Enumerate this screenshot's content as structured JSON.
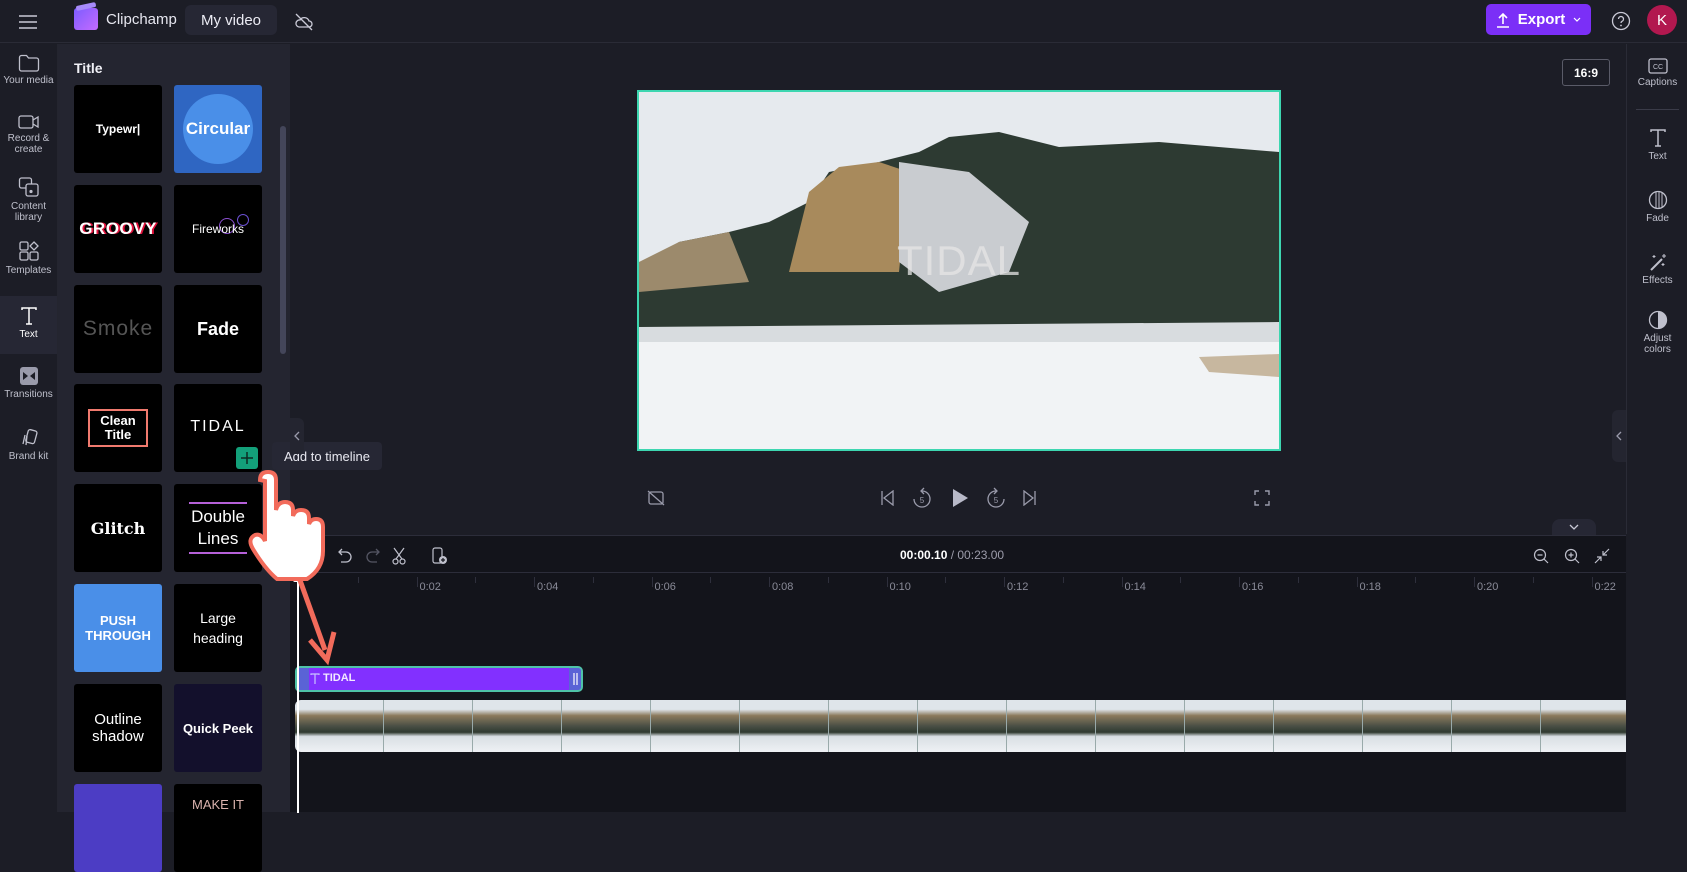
{
  "topbar": {
    "app_name": "Clipchamp",
    "project_title": "My video",
    "export_label": "Export",
    "avatar_initial": "K",
    "colors": {
      "export": "#7b2ff7",
      "avatar": "#b2184f"
    }
  },
  "left_rail": {
    "items": [
      {
        "label": "Your media",
        "icon": "folder-icon"
      },
      {
        "label": "Record & create",
        "icon": "camera-icon"
      },
      {
        "label": "Content library",
        "icon": "library-icon"
      },
      {
        "label": "Templates",
        "icon": "templates-icon"
      },
      {
        "label": "Text",
        "icon": "text-icon",
        "active": true
      },
      {
        "label": "Transitions",
        "icon": "transitions-icon"
      },
      {
        "label": "Brand kit",
        "icon": "brand-kit-icon"
      }
    ]
  },
  "panel": {
    "title": "Title",
    "tiles": [
      {
        "label": "Typewr|"
      },
      {
        "label": "Circular"
      },
      {
        "label": "GROOVY"
      },
      {
        "label": "Fireworks"
      },
      {
        "label": "Smoke"
      },
      {
        "label": "Fade"
      },
      {
        "label": "Clean Title"
      },
      {
        "label": "TIDAL"
      },
      {
        "label": "Glitch"
      },
      {
        "label": "Double Lines"
      },
      {
        "label": "PUSH THROUGH"
      },
      {
        "label": "Large heading"
      },
      {
        "label": "Outline shadow"
      },
      {
        "label": "Quick Peek"
      },
      {
        "label": ""
      },
      {
        "label": "MAKE IT"
      }
    ],
    "tooltip": "Add to timeline"
  },
  "preview": {
    "overlay_text": "TIDAL",
    "aspect_ratio": "16:9"
  },
  "right_rail": {
    "items": [
      {
        "label": "Captions",
        "icon": "captions-icon"
      },
      {
        "label": "Text",
        "icon": "text-icon"
      },
      {
        "label": "Fade",
        "icon": "fade-icon"
      },
      {
        "label": "Effects",
        "icon": "effects-icon"
      },
      {
        "label": "Adjust colors",
        "icon": "adjust-colors-icon"
      }
    ]
  },
  "timeline": {
    "current_time": "00:00.10",
    "total_time": "/ 00:23.00",
    "ruler_ticks": [
      "0:02",
      "0:04",
      "0:06",
      "0:08",
      "0:10",
      "0:12",
      "0:14",
      "0:16",
      "0:18",
      "0:20",
      "0:22"
    ],
    "text_clip_label": "TIDAL",
    "colors": {
      "text_clip": "#8230ff",
      "selection": "#4fc3a8"
    }
  }
}
